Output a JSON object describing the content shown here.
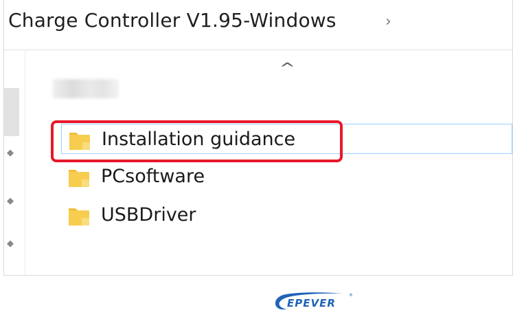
{
  "window": {
    "breadcrumb": "Charge Controller V1.95-Windows",
    "breadcrumb_separator": "›"
  },
  "list": {
    "sort_indicator": "^",
    "items": [
      {
        "name": "Installation guidance",
        "type": "folder",
        "selected": true,
        "highlighted": true
      },
      {
        "name": "PCsoftware",
        "type": "folder",
        "selected": false
      },
      {
        "name": "USBDriver",
        "type": "folder",
        "selected": false
      }
    ]
  },
  "brand": {
    "logo_text": "EPEVER",
    "registered_mark": "®"
  },
  "colors": {
    "folder": "#f7cd4f",
    "folder_tab": "#f2bc3a",
    "highlight": "#e8182a",
    "selection": "#99d1ff",
    "brand": "#1f63b8"
  }
}
